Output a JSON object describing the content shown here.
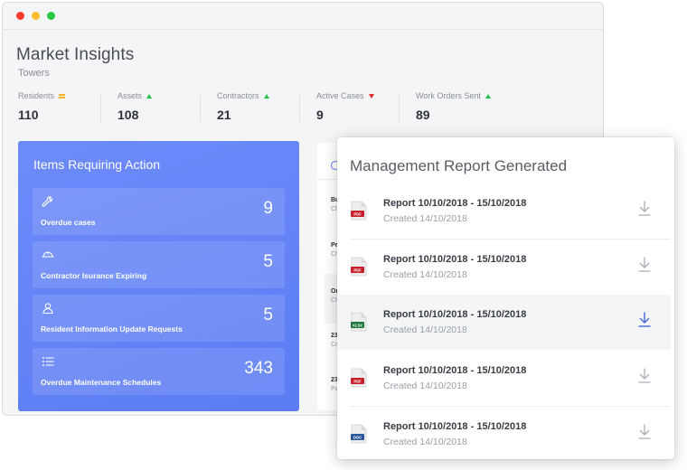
{
  "header": {
    "title": "Market Insights",
    "subtitle": "Towers"
  },
  "stats": [
    {
      "label": "Residents",
      "value": "110",
      "trend": "flat"
    },
    {
      "label": "Assets",
      "value": "108",
      "trend": "up"
    },
    {
      "label": "Contractors",
      "value": "21",
      "trend": "up"
    },
    {
      "label": "Active Cases",
      "value": "9",
      "trend": "down"
    },
    {
      "label": "Work Orders Sent",
      "value": "89",
      "trend": "up"
    }
  ],
  "action_panel": {
    "title": "Items Requiring Action",
    "items": [
      {
        "label": "Overdue cases",
        "count": "9",
        "icon": "wrench-icon"
      },
      {
        "label": "Contractor Isurance Expiring",
        "count": "5",
        "icon": "helmet-icon"
      },
      {
        "label": "Resident Information Update Requests",
        "count": "5",
        "icon": "user-icon"
      },
      {
        "label": "Overdue Maintenance Schedules",
        "count": "343",
        "icon": "checklist-icon"
      }
    ]
  },
  "background_list": {
    "rows": [
      {
        "line1": "Bu",
        "line2": "Ch"
      },
      {
        "line1": "Pe",
        "line2": "Ch"
      },
      {
        "line1": "Or",
        "line2": "Ch"
      },
      {
        "line1": "23",
        "line2": "Co"
      },
      {
        "line1": "23",
        "line2": "Pa"
      }
    ]
  },
  "modal": {
    "title": "Management Report Generated",
    "reports": [
      {
        "title": "Report 10/10/2018 - 15/10/2018",
        "created": "Created 14/10/2018",
        "type": "PDF"
      },
      {
        "title": "Report 10/10/2018 - 15/10/2018",
        "created": "Created 14/10/2018",
        "type": "PDF"
      },
      {
        "title": "Report 10/10/2018 - 15/10/2018",
        "created": "Created 14/10/2018",
        "type": "XLSX"
      },
      {
        "title": "Report 10/10/2018 - 15/10/2018",
        "created": "Created 14/10/2018",
        "type": "PDF"
      },
      {
        "title": "Report 10/10/2018 - 15/10/2018",
        "created": "Created 14/10/2018",
        "type": "DOC"
      }
    ]
  },
  "colors": {
    "pdf": "#c8202a",
    "xlsx": "#1e7a3c",
    "doc": "#2b579a",
    "accent": "#5b7cf4",
    "up": "#27c24c",
    "down": "#e3272d",
    "flat": "#f0b429"
  }
}
